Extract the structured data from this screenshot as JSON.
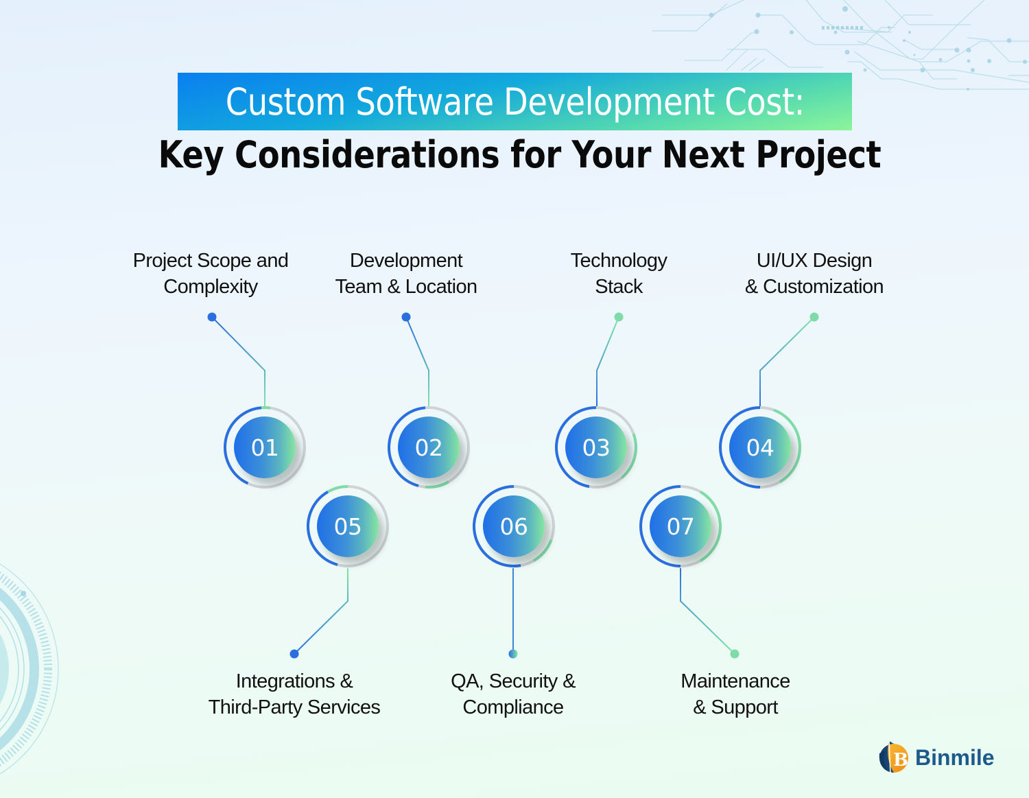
{
  "title": {
    "line1": "Custom Software Development Cost:",
    "line2": "Key Considerations for Your Next Project"
  },
  "colors": {
    "title_gradient_start": "#0a7ff0",
    "title_gradient_end": "#8cf59a",
    "node_blue": "#1f6fe8",
    "node_green": "#88e6a0",
    "ring_gray": "#cfd3d6",
    "logo_blue": "#1d5a8c",
    "logo_orange": "#f7a21c"
  },
  "factors": [
    {
      "number": "01",
      "line1": "Project Scope and",
      "line2": "Complexity",
      "position": "top"
    },
    {
      "number": "02",
      "line1": "Development",
      "line2": "Team & Location",
      "position": "top"
    },
    {
      "number": "03",
      "line1": "Technology",
      "line2": "Stack",
      "position": "top"
    },
    {
      "number": "04",
      "line1": "UI/UX Design",
      "line2": "& Customization",
      "position": "top"
    },
    {
      "number": "05",
      "line1": "Integrations &",
      "line2": "Third-Party Services",
      "position": "bottom"
    },
    {
      "number": "06",
      "line1": "QA, Security &",
      "line2": "Compliance",
      "position": "bottom"
    },
    {
      "number": "07",
      "line1": "Maintenance",
      "line2": "& Support",
      "position": "bottom"
    }
  ],
  "brand": {
    "name": "Binmile",
    "icon": "binmile-logo-icon"
  },
  "decorations": {
    "top_right": "circuit-pattern",
    "bottom_left": "radial-gauge-pattern"
  }
}
